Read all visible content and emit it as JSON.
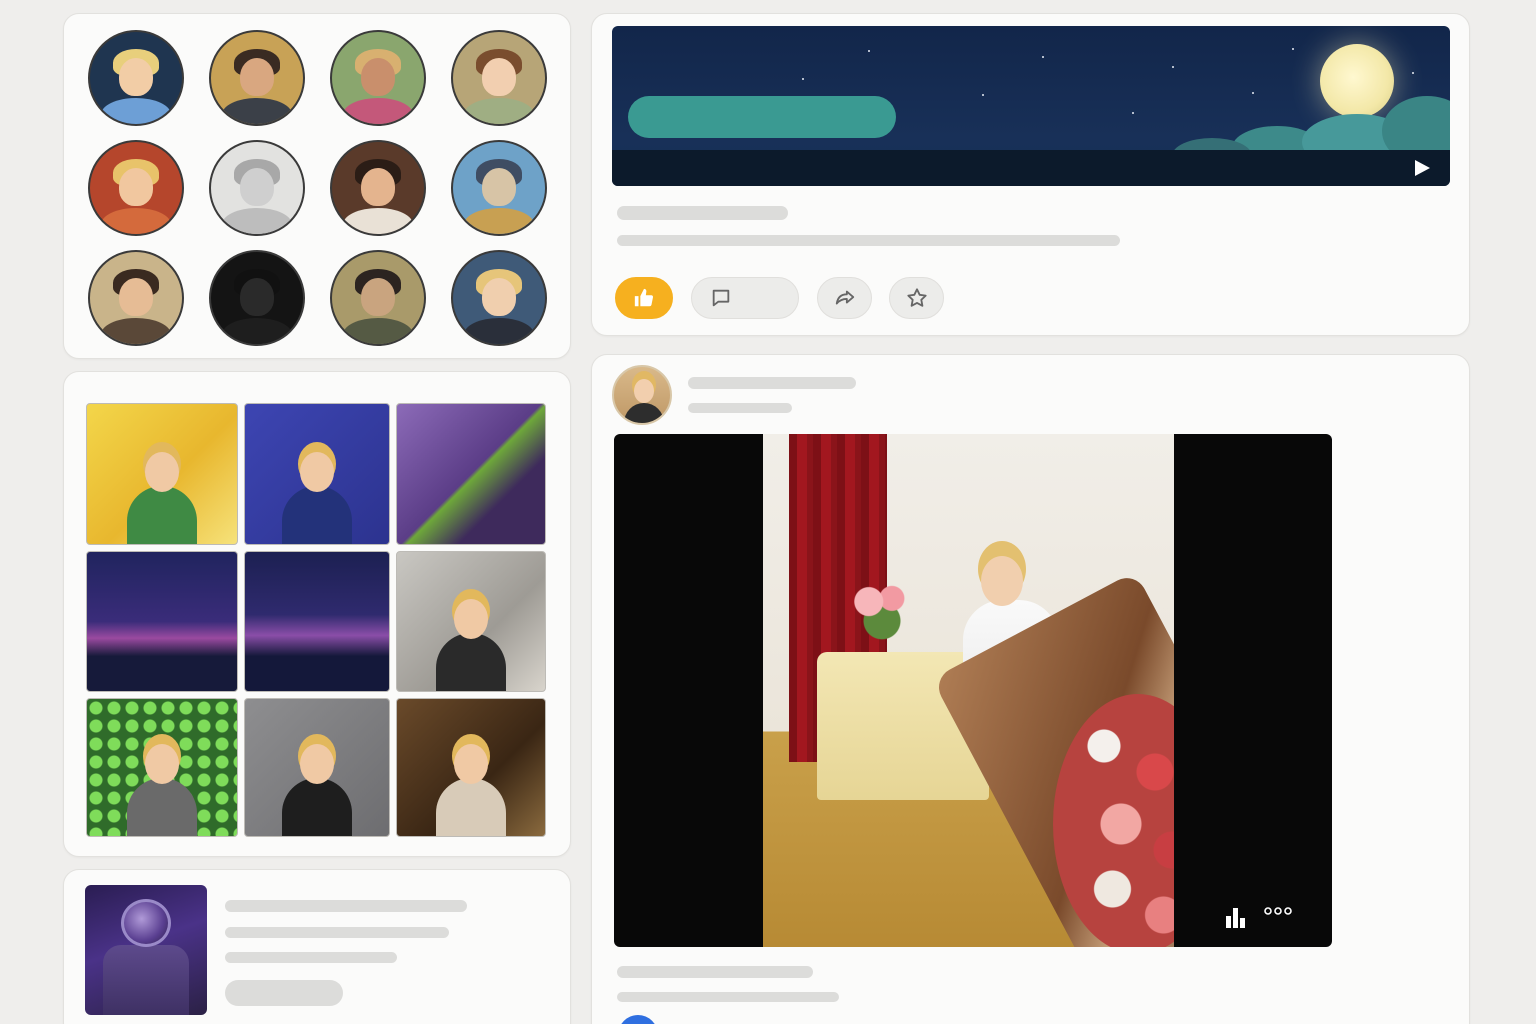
{
  "friends": {
    "avatars": [
      {
        "name": "friend-1",
        "bg": "#1f3550",
        "skin": "#f2cda6",
        "hair": "#e8cf7c",
        "cloth": "#6d9fd6"
      },
      {
        "name": "friend-2",
        "bg": "#c8a256",
        "skin": "#d9a780",
        "hair": "#3a2b22",
        "cloth": "#3b4048"
      },
      {
        "name": "friend-3",
        "bg": "#8aa66e",
        "skin": "#c98f6c",
        "hair": "#d8b070",
        "cloth": "#c4587a"
      },
      {
        "name": "friend-4",
        "bg": "#b7a577",
        "skin": "#f2cfb0",
        "hair": "#7a4d2e",
        "cloth": "#9fae83"
      },
      {
        "name": "friend-5",
        "bg": "#b5462c",
        "skin": "#f1c79f",
        "hair": "#e8c36a",
        "cloth": "#d46a3c"
      },
      {
        "name": "friend-6",
        "bg": "#e2e2e0",
        "skin": "#cfcfcf",
        "hair": "#a8a8a8",
        "cloth": "#bdbdbd"
      },
      {
        "name": "friend-7",
        "bg": "#5a3a2a",
        "skin": "#e4b48e",
        "hair": "#2b1d16",
        "cloth": "#e9e1d6"
      },
      {
        "name": "friend-8",
        "bg": "#6ea2c8",
        "skin": "#d7c4a6",
        "hair": "#3f4d63",
        "cloth": "#c8a052"
      },
      {
        "name": "friend-9",
        "bg": "#c9b48a",
        "skin": "#e6bc95",
        "hair": "#3a2a20",
        "cloth": "#5a4838"
      },
      {
        "name": "friend-10",
        "bg": "#141414",
        "skin": "#2a2a2a",
        "hair": "#111111",
        "cloth": "#1e1e1e"
      },
      {
        "name": "friend-11",
        "bg": "#a99a6a",
        "skin": "#c9a47f",
        "hair": "#2c2420",
        "cloth": "#555a44"
      },
      {
        "name": "friend-12",
        "bg": "#3f5a78",
        "skin": "#f0cfae",
        "hair": "#e6c57a",
        "cloth": "#2a2f3a"
      }
    ]
  },
  "photos": {
    "items": [
      {
        "name": "photo-1",
        "bg": "linear-gradient(135deg,#f3d64a,#e8b72e 55%,#f6e27a)",
        "cloth": "#3f8a44"
      },
      {
        "name": "photo-2",
        "bg": "linear-gradient(135deg,#3d45b2,#2c338f)",
        "cloth": "#23327a"
      },
      {
        "name": "photo-3",
        "bg": "linear-gradient(135deg,#8c6bb8,#5b3d87 50%,#6ea83a 52%,#3e2a5c 70%)",
        "cloth": "transparent"
      },
      {
        "name": "photo-4",
        "bg": "linear-gradient(180deg,#20245e,#3a2c7a 50%,#9a4aa0 62%,#161a3a 75%)",
        "cloth": "transparent"
      },
      {
        "name": "photo-5",
        "bg": "linear-gradient(180deg,#1c2052,#2f2a6e 45%,#8a4ea8 60%,#14183a 75%)",
        "cloth": "transparent"
      },
      {
        "name": "photo-6",
        "bg": "linear-gradient(135deg,#c9c7c2,#9e9b95 60%,#d8d4cc)",
        "cloth": "#2a2a2a"
      },
      {
        "name": "photo-7",
        "bg": "radial-gradient(circle,#7fdc5a 0 6px,#2f6b2a 7px) 0 0/18px 18px,#2f6b2a",
        "cloth": "#6a6a6a"
      },
      {
        "name": "photo-8",
        "bg": "linear-gradient(135deg,#8e8e90,#6d6d70)",
        "cloth": "#1e1e1e"
      },
      {
        "name": "photo-9",
        "bg": "linear-gradient(135deg,#6a4a2a,#3a2614 60%,#8a6a3e)",
        "cloth": "#d8cbb8"
      }
    ]
  },
  "colors": {
    "like_active": "#f6b01f",
    "card_bg": "#fbfbfa",
    "page_bg": "#efeeec",
    "skeleton": "#dcdcda"
  },
  "icons": {
    "like": "thumbs-up-icon",
    "comment": "comment-icon",
    "share": "share-icon",
    "bookmark": "star-icon",
    "play": "play-icon",
    "stats": "stats-icon",
    "more": "more-icon"
  }
}
